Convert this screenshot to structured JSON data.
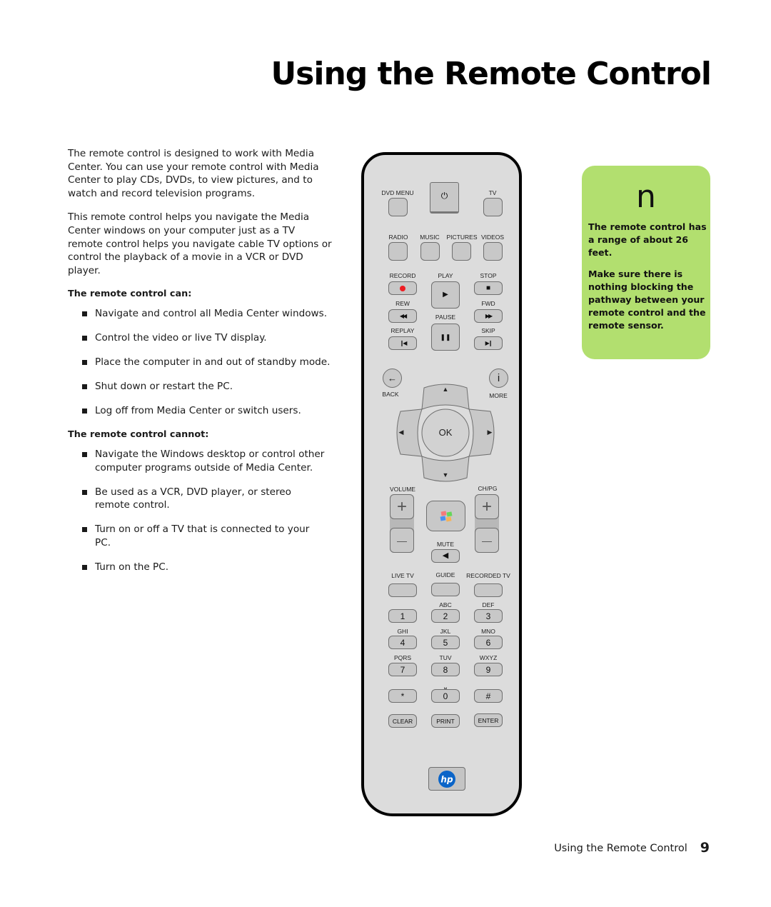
{
  "page": {
    "title": "Using the Remote Control",
    "intro": [
      "The remote control is designed to work with Media Center. You can use your remote control with Media Center to play CDs, DVDs, to view pictures, and to watch and record television programs.",
      "This remote control helps you navigate the Media Center windows on your computer just as a TV remote control helps you navigate cable TV options or control the playback of a movie in a VCR or DVD player."
    ],
    "can": {
      "heading": "The remote control can:",
      "items": [
        "Navigate and control all Media Center windows.",
        "Control the video or live TV display.",
        "Place the computer in and out of standby mode.",
        "Shut down or restart the PC.",
        "Log off from Media Center or switch users."
      ]
    },
    "cannot": {
      "heading": "The remote control cannot:",
      "items": [
        "Navigate the Windows desktop or control other computer programs outside of Media Center.",
        "Be used as a VCR, DVD player, or stereo remote control.",
        "Turn on or off a TV that is connected to your PC.",
        "Turn on the PC."
      ]
    },
    "callout": {
      "icon": "n",
      "paragraphs": [
        "The remote control has a range of about 26 feet.",
        "Make sure there is nothing blocking the pathway between your remote control and the remote sensor."
      ],
      "color": "#b2df6f"
    },
    "footer": {
      "section": "Using the Remote Control",
      "page_number": "9"
    }
  },
  "remote": {
    "labels": {
      "dvd_menu": "DVD MENU",
      "tv": "TV",
      "radio": "RADIO",
      "music": "MUSIC",
      "pictures": "PICTURES",
      "videos": "VIDEOS",
      "record": "RECORD",
      "play": "PLAY",
      "stop": "STOP",
      "rew": "REW",
      "pause": "PAUSE",
      "fwd": "FWD",
      "replay": "REPLAY",
      "skip": "SKIP",
      "back": "BACK",
      "more": "MORE",
      "ok": "OK",
      "volume": "VOLUME",
      "chpg": "CH/PG",
      "mute": "MUTE",
      "live_tv": "LIVE TV",
      "guide": "GUIDE",
      "recorded_tv": "RECORDED TV",
      "clear": "CLEAR",
      "print": "PRINT",
      "enter": "ENTER"
    },
    "glyphs": {
      "power": "⏻",
      "play": "▶",
      "stop": "■",
      "rew": "◀◀",
      "fwd": "▶▶",
      "pause": "❚❚",
      "replay": "❙◀",
      "skip": "▶❙",
      "back": "←",
      "more": "i",
      "up": "▲",
      "down": "▼",
      "left": "◀",
      "right": "▶",
      "plus": "+",
      "minus": "—",
      "mute": "◀",
      "space": "⎵"
    },
    "keypad": [
      {
        "key": "1",
        "letters": ""
      },
      {
        "key": "2",
        "letters": "ABC"
      },
      {
        "key": "3",
        "letters": "DEF"
      },
      {
        "key": "4",
        "letters": "GHI"
      },
      {
        "key": "5",
        "letters": "JKL"
      },
      {
        "key": "6",
        "letters": "MNO"
      },
      {
        "key": "7",
        "letters": "PQRS"
      },
      {
        "key": "8",
        "letters": "TUV"
      },
      {
        "key": "9",
        "letters": "WXYZ"
      },
      {
        "key": "*",
        "letters": ""
      },
      {
        "key": "0",
        "letters": "⎵"
      },
      {
        "key": "#",
        "letters": ""
      }
    ],
    "logo": "hp",
    "colors": {
      "record": "#ee1d23",
      "hp_blue": "#0a64c8",
      "body": "#dcdcdc",
      "button": "#c8c8c8"
    }
  }
}
